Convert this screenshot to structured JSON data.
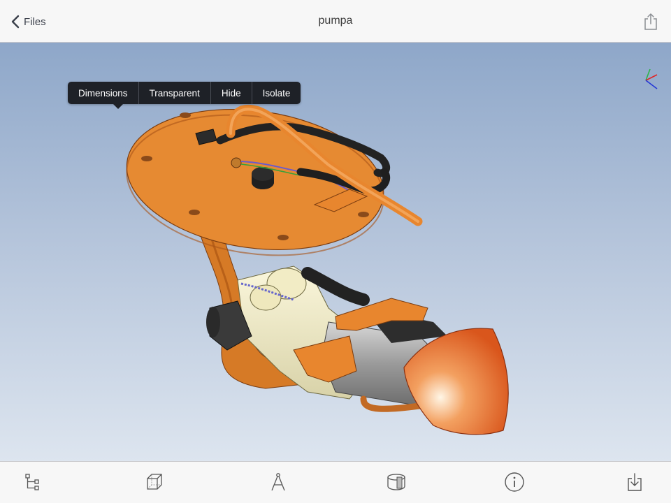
{
  "navbar": {
    "back_label": "Files",
    "title": "pumpa"
  },
  "context_menu": {
    "items": [
      "Dimensions",
      "Transparent",
      "Hide",
      "Isolate"
    ]
  },
  "toolbar": {
    "icons": [
      "tree-icon",
      "box-icon",
      "compass-icon",
      "section-icon",
      "info-icon",
      "download-icon"
    ]
  },
  "colors": {
    "accent_text": "#3a3f4a",
    "menu_bg": "#1e2127",
    "model_orange": "#e8862e",
    "sky_top": "#8ea7c9",
    "sky_bottom": "#dde5ef"
  }
}
